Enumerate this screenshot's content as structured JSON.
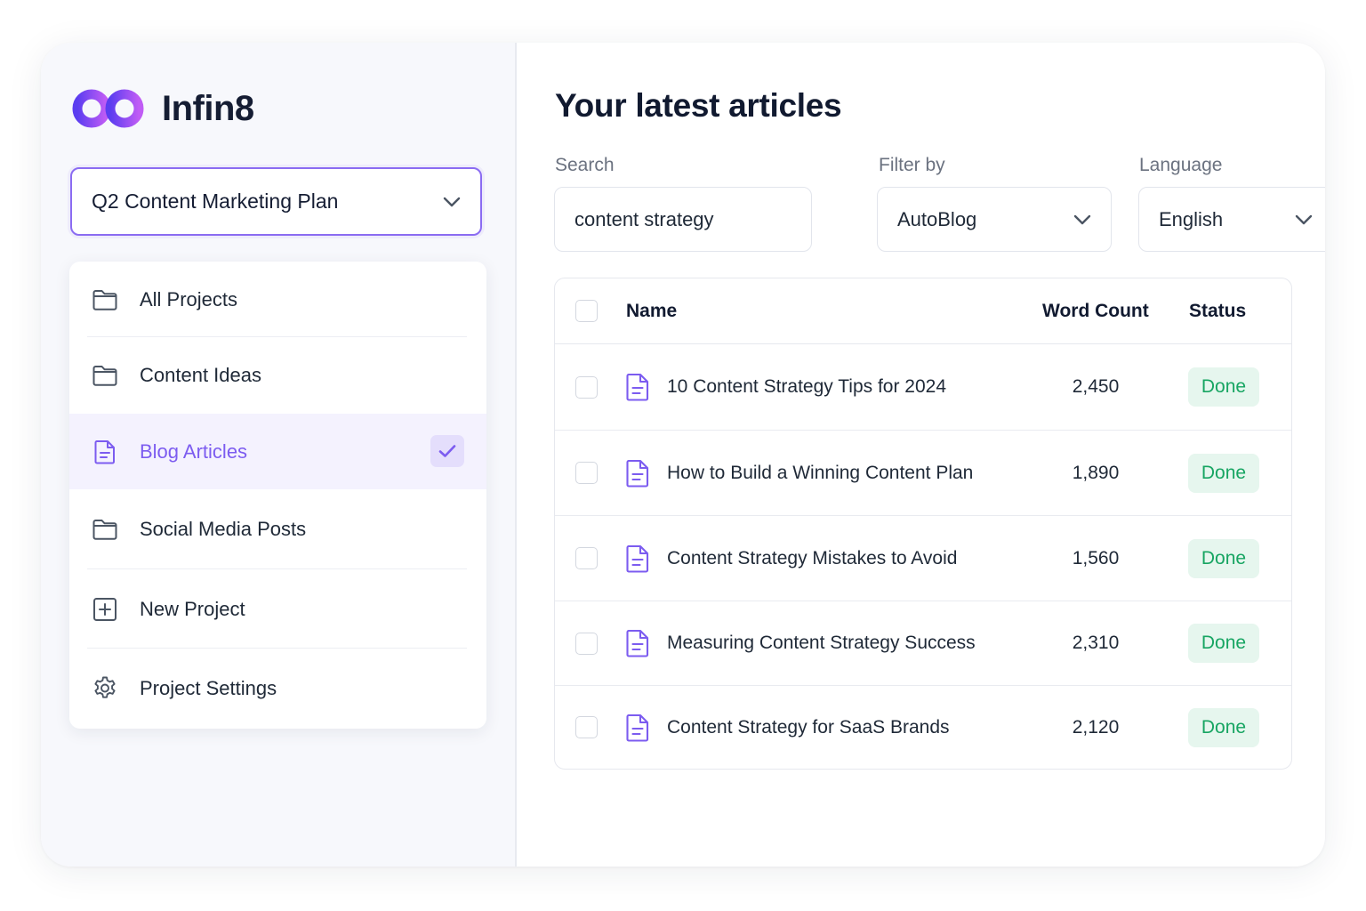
{
  "app": {
    "name": "Infin8"
  },
  "sidebar": {
    "project": "Q2 Content Marketing Plan",
    "items": [
      {
        "label": "All Projects",
        "icon": "folder-icon",
        "active": false
      },
      {
        "label": "Content Ideas",
        "icon": "folder-icon",
        "active": false
      },
      {
        "label": "Blog Articles",
        "icon": "document-icon",
        "active": true
      },
      {
        "label": "Social Media Posts",
        "icon": "folder-icon",
        "active": false
      },
      {
        "label": "New Project",
        "icon": "plus-square-icon",
        "active": false
      },
      {
        "label": "Project Settings",
        "icon": "gear-icon",
        "active": false
      }
    ]
  },
  "main": {
    "title": "Your latest articles",
    "search": {
      "label": "Search",
      "value": "content strategy"
    },
    "filter": {
      "label": "Filter by",
      "value": "AutoBlog"
    },
    "language": {
      "label": "Language",
      "value": "English"
    },
    "table": {
      "headers": {
        "name": "Name",
        "word_count": "Word Count",
        "status": "Status"
      },
      "rows": [
        {
          "name": "10 Content Strategy Tips for 2024",
          "word_count": "2,450",
          "status": "Done"
        },
        {
          "name": "How to Build a Winning Content Plan",
          "word_count": "1,890",
          "status": "Done"
        },
        {
          "name": "Content Strategy Mistakes to Avoid",
          "word_count": "1,560",
          "status": "Done"
        },
        {
          "name": "Measuring Content Strategy Success",
          "word_count": "2,310",
          "status": "Done"
        },
        {
          "name": "Content Strategy for SaaS Brands",
          "word_count": "2,120",
          "status": "Done"
        }
      ]
    }
  },
  "colors": {
    "accent": "#7c5cf0",
    "logo_start": "#5b3df0",
    "logo_end": "#c05cf5",
    "done_bg": "#e6f6ee",
    "done_text": "#17a562"
  }
}
